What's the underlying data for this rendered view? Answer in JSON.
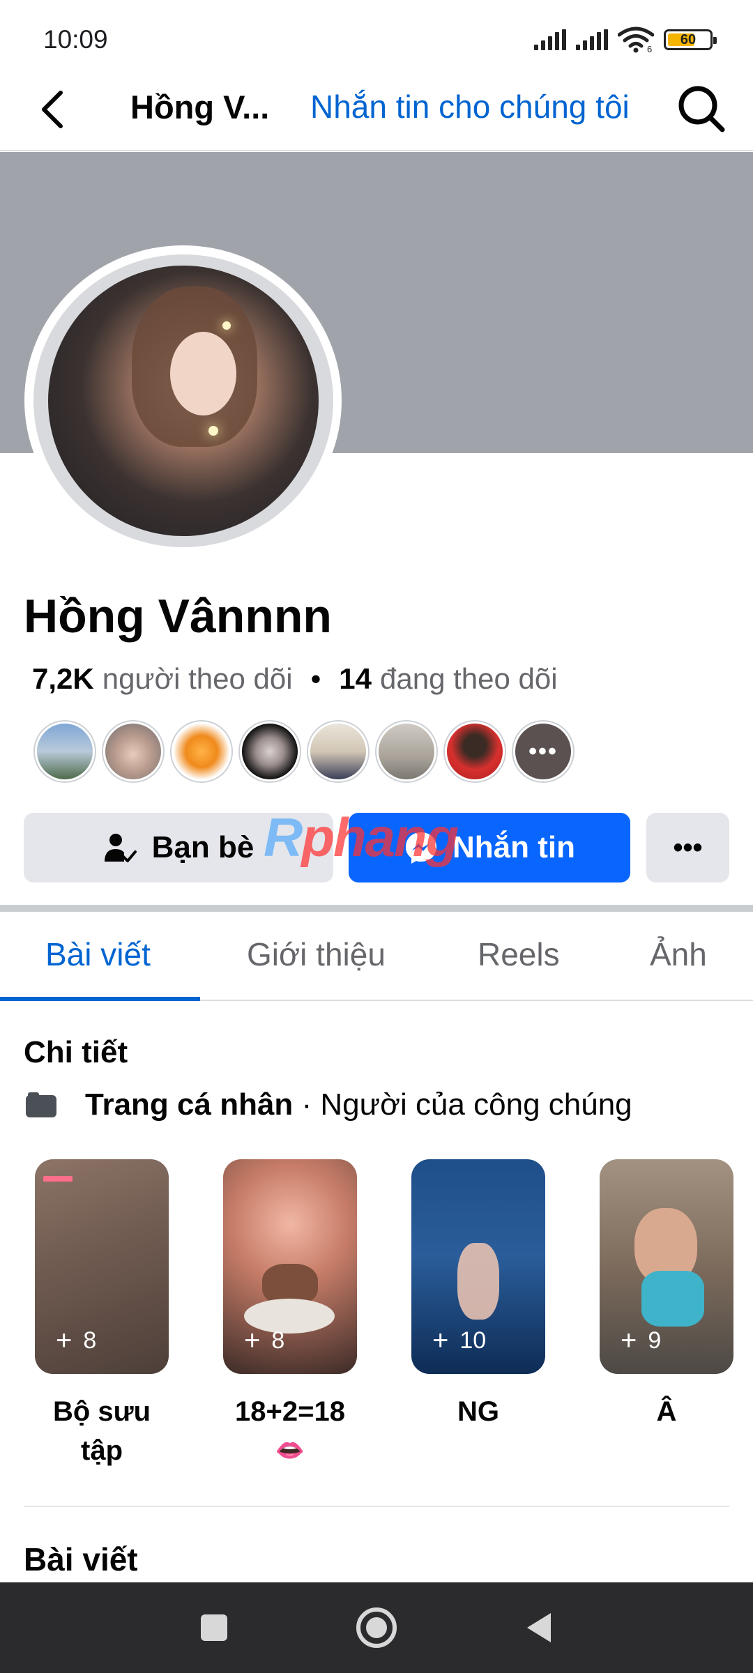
{
  "status_bar": {
    "time": "10:09",
    "battery": 60,
    "battery_label": "60",
    "wifi_badge": "6"
  },
  "header": {
    "title": "Hồng V...",
    "link": "Nhắn tin cho chúng tôi"
  },
  "profile": {
    "name": "Hồng Vânnnn",
    "followers_count": "7,2K",
    "followers_label": "người theo dõi",
    "following_count": "14",
    "following_label": "đang theo dõi",
    "more_friends_label": "•••"
  },
  "actions": {
    "friends_label": "Bạn bè",
    "message_label": "Nhắn tin",
    "more_label": "•••"
  },
  "watermark": {
    "prefix": "R",
    "text": "phang"
  },
  "tabs": [
    "Bài viết",
    "Giới thiệu",
    "Reels",
    "Ảnh"
  ],
  "details": {
    "heading": "Chi tiết",
    "page_type": "Trang cá nhân",
    "separator": " · ",
    "category": "Người của công chúng"
  },
  "highlights": [
    {
      "count": "8",
      "title": "Bộ sưu tập"
    },
    {
      "count": "8",
      "title": "18+2=18",
      "emoji": "👄"
    },
    {
      "count": "10",
      "title": "NG"
    },
    {
      "count": "9",
      "title": "Â"
    }
  ],
  "posts_heading": "Bài viết",
  "colors": {
    "accent": "#0064d1",
    "primary_button": "#0866ff",
    "secondary_button": "#e4e6eb",
    "cover": "#a0a4aa"
  }
}
